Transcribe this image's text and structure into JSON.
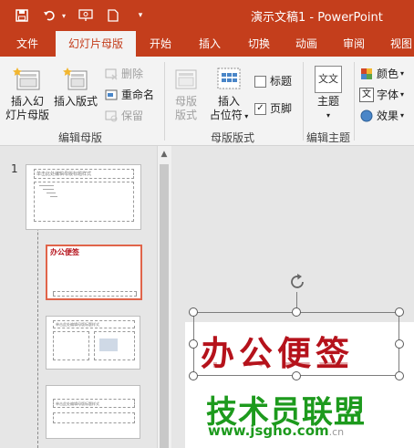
{
  "window": {
    "title": "演示文稿1 - PowerPoint"
  },
  "quick_access": [
    "save-icon",
    "undo-icon",
    "undo-dropdown-icon",
    "present-icon",
    "new-icon",
    "customize-icon"
  ],
  "tabs": [
    {
      "label": "文件"
    },
    {
      "label": "幻灯片母版",
      "active": true
    },
    {
      "label": "开始"
    },
    {
      "label": "插入"
    },
    {
      "label": "切换"
    },
    {
      "label": "动画"
    },
    {
      "label": "审阅"
    },
    {
      "label": "视图"
    }
  ],
  "ribbon": {
    "edit_master": {
      "group_label": "编辑母版",
      "insert_slide_master": {
        "line1": "插入幻",
        "line2": "灯片母版"
      },
      "insert_layout": {
        "label": "插入版式"
      },
      "delete": {
        "label": "删除"
      },
      "rename": {
        "label": "重命名"
      },
      "preserve": {
        "label": "保留"
      }
    },
    "master_layout": {
      "group_label": "母版版式",
      "master_layout_btn": {
        "line1": "母版",
        "line2": "版式"
      },
      "insert_placeholder": {
        "line1": "插入",
        "line2": "占位符"
      },
      "title_checkbox": {
        "label": "标题",
        "checked": false
      },
      "footer_checkbox": {
        "label": "页脚",
        "checked": true
      }
    },
    "edit_theme": {
      "group_label": "编辑主题",
      "theme": {
        "label": "主题",
        "icon_text": "文文"
      },
      "colors": {
        "label": "颜色"
      },
      "fonts": {
        "label": "字体"
      },
      "effects": {
        "label": "效果"
      }
    }
  },
  "thumbnail_pane": {
    "slide_number": "1",
    "master_title": "单击此处编辑母版标题样式",
    "layout2_title": "办公便签",
    "layout3_title": "单击此处编辑母版标题样式",
    "layout4_title": "单击此处编辑母版标题样式"
  },
  "slide": {
    "wordart_text": "办公便签"
  },
  "watermark": {
    "cn": "技术员联盟",
    "url": "www.jsgho.com",
    "suffix": ".cn"
  },
  "colors": {
    "accent": "#c43e1c",
    "selection": "#e0644a",
    "wordart": "#b5121b",
    "watermark": "#1d9a1d"
  }
}
